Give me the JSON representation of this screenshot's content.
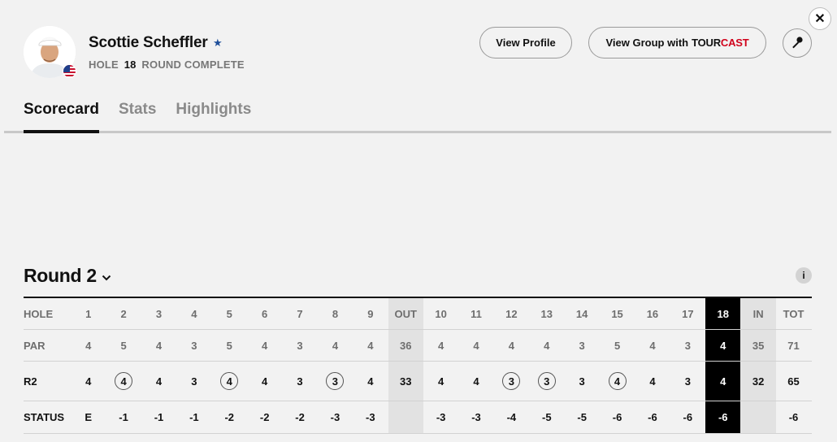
{
  "player": {
    "name": "Scottie Scheffler",
    "hole_label": "HOLE",
    "hole_number": "18",
    "round_status": "ROUND COMPLETE"
  },
  "actions": {
    "view_profile": "View Profile",
    "view_group": "View Group with",
    "tourcast_tour": "TOUR",
    "tourcast_cast": "CAST"
  },
  "tabs": [
    {
      "label": "Scorecard",
      "active": true
    },
    {
      "label": "Stats",
      "active": false
    },
    {
      "label": "Highlights",
      "active": false
    }
  ],
  "round": {
    "title": "Round 2",
    "info": "i"
  },
  "scorecard": {
    "labels": {
      "hole": "HOLE",
      "par": "PAR",
      "score": "R2",
      "status": "STATUS"
    },
    "columns": [
      "1",
      "2",
      "3",
      "4",
      "5",
      "6",
      "7",
      "8",
      "9",
      "OUT",
      "10",
      "11",
      "12",
      "13",
      "14",
      "15",
      "16",
      "17",
      "18",
      "IN",
      "TOT"
    ],
    "par": [
      "4",
      "5",
      "4",
      "3",
      "5",
      "4",
      "3",
      "4",
      "4",
      "36",
      "4",
      "4",
      "4",
      "4",
      "3",
      "5",
      "4",
      "3",
      "4",
      "35",
      "71"
    ],
    "score": [
      "4",
      "4",
      "4",
      "3",
      "4",
      "4",
      "3",
      "3",
      "4",
      "33",
      "4",
      "4",
      "3",
      "3",
      "3",
      "4",
      "4",
      "3",
      "4",
      "32",
      "65"
    ],
    "status": [
      "E",
      "-1",
      "-1",
      "-1",
      "-2",
      "-2",
      "-2",
      "-3",
      "-3",
      "",
      "-3",
      "-3",
      "-4",
      "-5",
      "-5",
      "-6",
      "-6",
      "-6",
      "-6",
      "",
      "-6"
    ],
    "birdie_columns": [
      1,
      4,
      7,
      12,
      13,
      15
    ],
    "subtotal_columns": [
      9,
      19
    ],
    "current_column": 18
  },
  "colors": {
    "background": "#f2f2f2",
    "accent_red": "#d0021b",
    "current_hole_bg": "#000000",
    "subtotal_bg": "#e2e2e2"
  },
  "icons": [
    "close-icon",
    "star-icon",
    "usa-flag-icon",
    "microphone-icon",
    "chevron-down-icon",
    "info-icon"
  ]
}
